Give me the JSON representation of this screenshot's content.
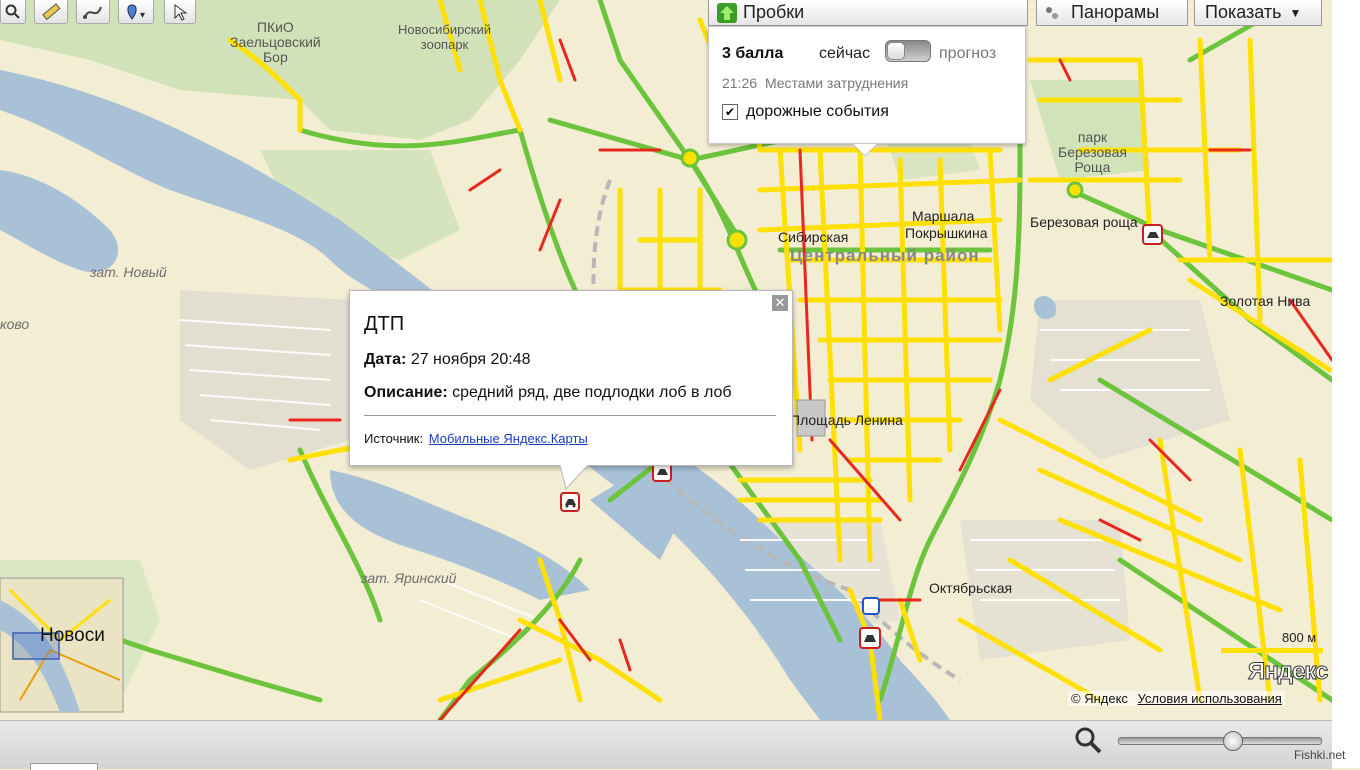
{
  "toolbar": {
    "traffic_button": "Пробки",
    "panoramas_button": "Панорамы",
    "show_button": "Показать"
  },
  "traffic_panel": {
    "score": "3 балла",
    "now_label": "сейчас",
    "forecast_label": "прогноз",
    "status_time": "21:26",
    "status_text": "Местами затруднения",
    "events_checkbox_label": "дорожные события",
    "events_checked": true
  },
  "incident_popup": {
    "title": "ДТП",
    "date_label": "Дата:",
    "date_value": "27 ноября 20:48",
    "description_label": "Описание:",
    "description_value": "средний ряд, две подлодки лоб в лоб",
    "source_label": "Источник:",
    "source_link": "Мобильные Яндекс.Карты"
  },
  "map_labels": {
    "forest_park": "ПКиО\nЗаельцовский\nБор",
    "zoo": "Новосибирский\nзоопарк",
    "novy": "зат. Новый",
    "kovo": "ково",
    "yarinsky": "зат. Яринский",
    "park_birch": "парк\nБерезовая\nРоща",
    "birch_grove": "Березовая роща",
    "marshala": "Маршала",
    "siberian": "Сибирская",
    "pokryshkina": "Покрышкина",
    "central_district": "Центральный район",
    "square_lenin": "Площадь Ленина",
    "zolotaya_niva": "Золотая Нива",
    "oktyabrskaya": "Октябрьская",
    "novosib_minimap": "Новоси"
  },
  "footer": {
    "scale": "800 м",
    "brand": "Яндекс",
    "copyright": "© Яндекс",
    "terms_link": "Условия использования",
    "watermark": "Fishki.net"
  },
  "zoom": {
    "level": 0.56
  },
  "colors": {
    "traffic_green": "#6cc43c",
    "traffic_yellow": "#ffe000",
    "traffic_red": "#e8281e",
    "water": "#a9c1d6",
    "land": "#f2ecd2",
    "greenery": "#cfe0b6",
    "link": "#1a3dc1"
  }
}
